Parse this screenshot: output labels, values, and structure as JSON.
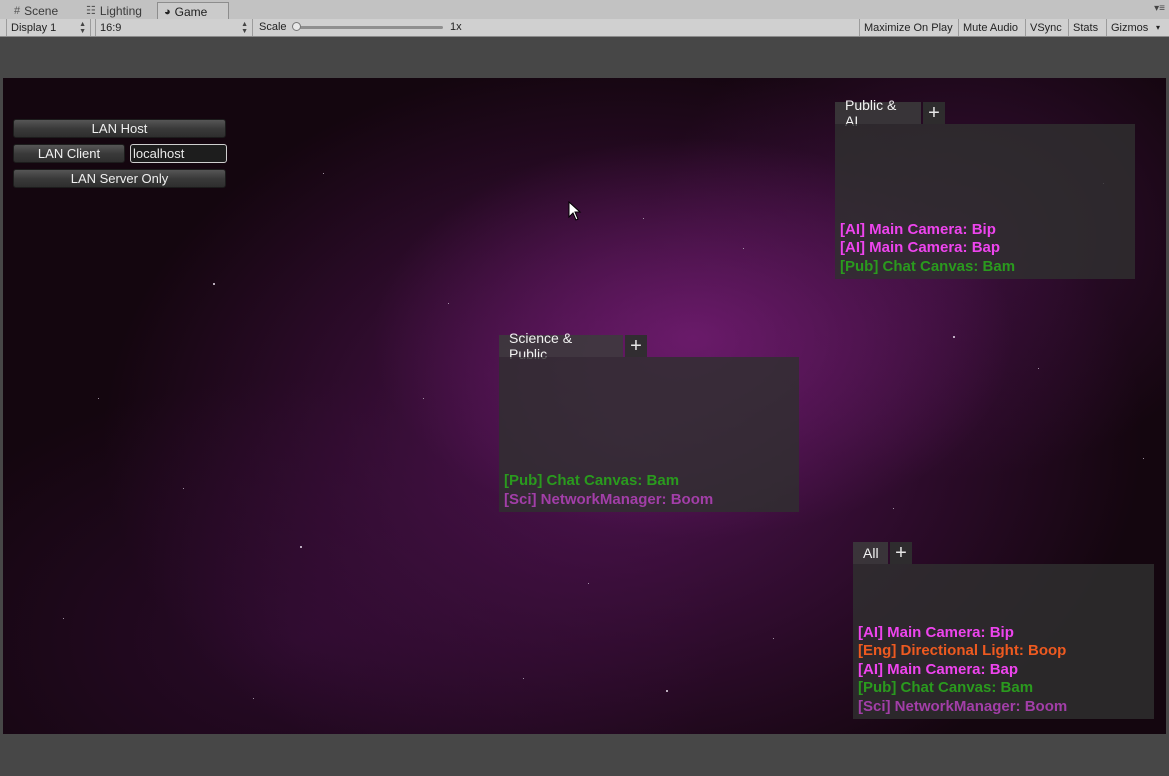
{
  "tabs": [
    {
      "label": "Scene",
      "icon": "grid-icon"
    },
    {
      "label": "Lighting",
      "icon": "lighting-icon"
    },
    {
      "label": "Game",
      "icon": "game-icon",
      "active": true
    }
  ],
  "toolbar": {
    "display": "Display 1",
    "aspect": "16:9",
    "scale_label": "Scale",
    "scale_value": "1x",
    "maximize": "Maximize On Play",
    "mute": "Mute Audio",
    "vsync": "VSync",
    "stats": "Stats",
    "gizmos": "Gizmos"
  },
  "lan": {
    "host": "LAN Host",
    "client": "LAN Client",
    "address": "localhost",
    "server": "LAN Server Only"
  },
  "colors": {
    "ai": "#ee44ee",
    "pub": "#2a9a1e",
    "sci": "#a23ea8",
    "eng": "#ee5a20"
  },
  "panels": {
    "public_ai": {
      "title": "Public & AI",
      "plus": "+",
      "messages": [
        {
          "text": "[AI] Main Camera: Bip",
          "channel": "ai"
        },
        {
          "text": "[AI] Main Camera: Bap",
          "channel": "ai"
        },
        {
          "text": "[Pub] Chat Canvas: Bam",
          "channel": "pub"
        }
      ]
    },
    "science_public": {
      "title": "Science & Public",
      "plus": "+",
      "messages": [
        {
          "text": "[Pub] Chat Canvas: Bam",
          "channel": "pub"
        },
        {
          "text": "[Sci] NetworkManager: Boom",
          "channel": "sci"
        }
      ]
    },
    "all": {
      "title": "All",
      "plus": "+",
      "messages": [
        {
          "text": "[AI] Main Camera: Bip",
          "channel": "ai"
        },
        {
          "text": "[Eng] Directional Light: Boop",
          "channel": "eng"
        },
        {
          "text": "[AI] Main Camera: Bap",
          "channel": "ai"
        },
        {
          "text": "[Pub] Chat Canvas: Bam",
          "channel": "pub"
        },
        {
          "text": "[Sci] NetworkManager: Boom",
          "channel": "sci"
        }
      ]
    }
  }
}
